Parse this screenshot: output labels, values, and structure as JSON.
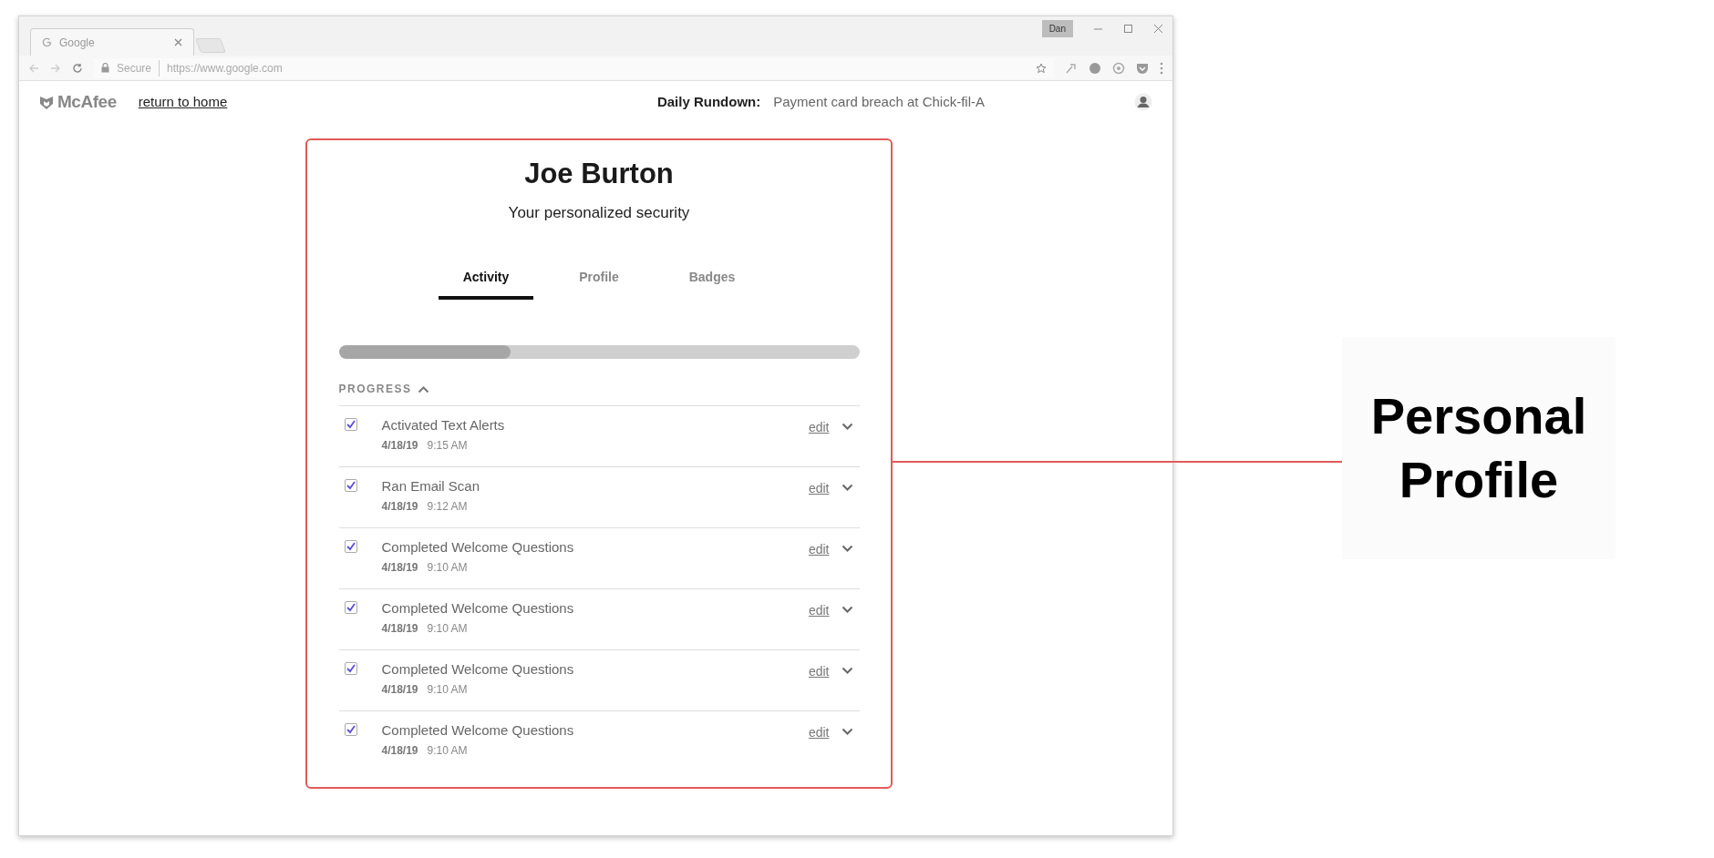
{
  "browser": {
    "tab": {
      "title": "Google"
    },
    "profile_badge": "Dan",
    "address": {
      "security": "Secure",
      "url": "https://www.google.com"
    }
  },
  "header": {
    "logo": "McAfee",
    "home_link": "return to home",
    "rundown_label": "Daily Rundown:",
    "rundown_text": "Payment card breach at Chick-fil-A"
  },
  "card": {
    "name": "Joe Burton",
    "subtitle": "Your personalized security",
    "tabs": [
      {
        "label": "Activity",
        "selected": true
      },
      {
        "label": "Profile",
        "selected": false
      },
      {
        "label": "Badges",
        "selected": false
      }
    ],
    "progress": {
      "level": 0.33,
      "label": "PROGRESS",
      "expanded": true
    },
    "activities": [
      {
        "title": "Activated Text Alerts",
        "date": "4/18/19",
        "time": "9:15 AM",
        "checked": true,
        "action": "edit"
      },
      {
        "title": "Ran Email Scan",
        "date": "4/18/19",
        "time": "9:12 AM",
        "checked": true,
        "action": "edit"
      },
      {
        "title": "Completed Welcome Questions",
        "date": "4/18/19",
        "time": "9:10 AM",
        "checked": true,
        "action": "edit"
      },
      {
        "title": "Completed Welcome Questions",
        "date": "4/18/19",
        "time": "9:10 AM",
        "checked": true,
        "action": "edit"
      },
      {
        "title": "Completed Welcome Questions",
        "date": "4/18/19",
        "time": "9:10 AM",
        "checked": true,
        "action": "edit"
      },
      {
        "title": "Completed Welcome Questions",
        "date": "4/18/19",
        "time": "9:10 AM",
        "checked": true,
        "action": "edit"
      }
    ]
  },
  "annotation": {
    "lines": [
      "Personal",
      "Profile"
    ]
  }
}
